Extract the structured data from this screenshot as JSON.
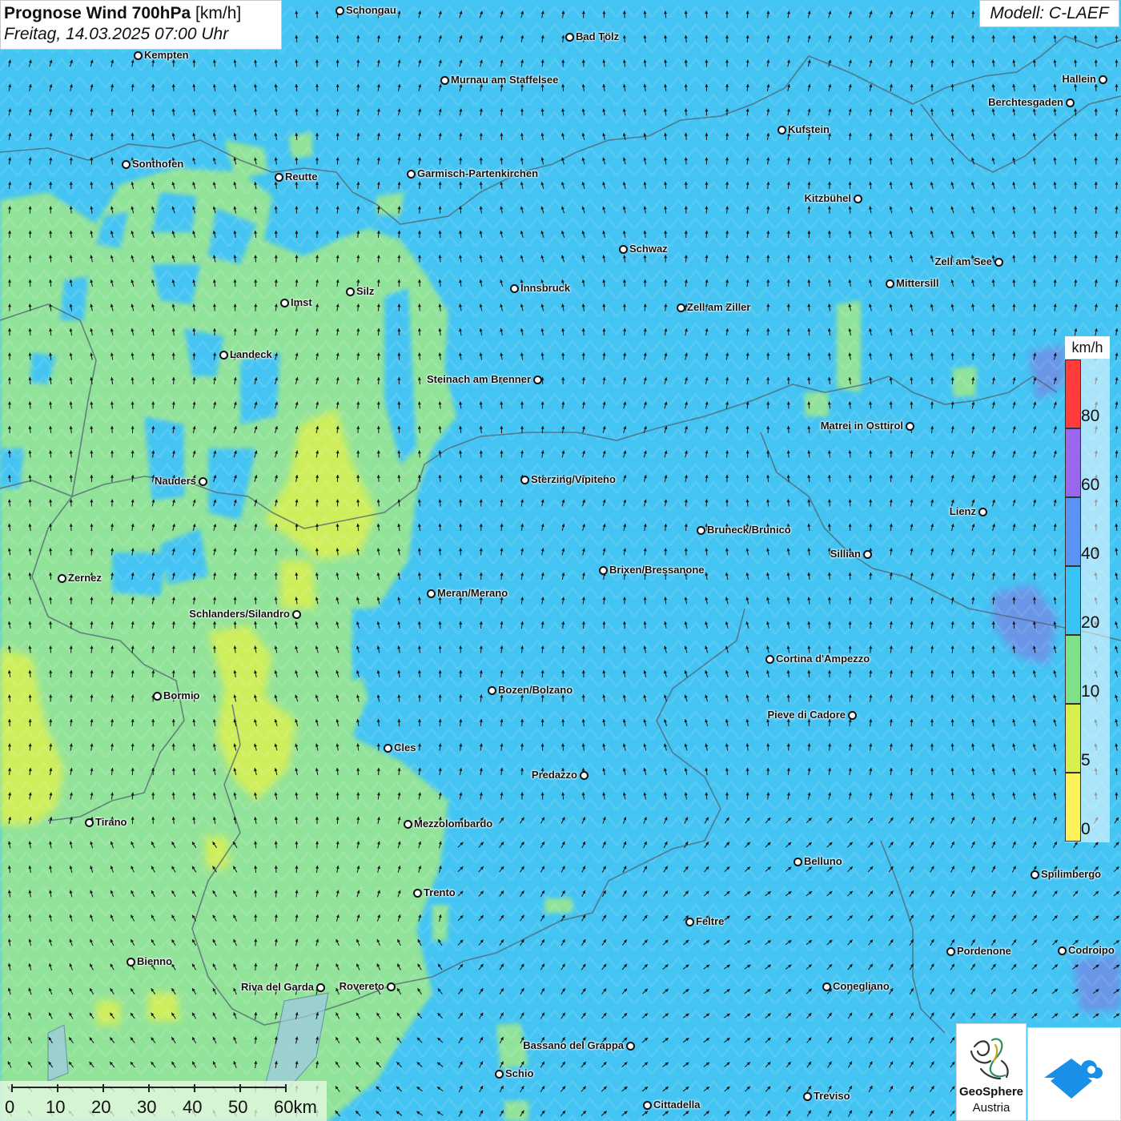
{
  "header": {
    "title_bold": "Prognose Wind 700hPa",
    "title_unit": "[km/h]",
    "date_line": "Freitag, 14.03.2025 07:00 Uhr"
  },
  "model": {
    "label": "Modell: C-LAEF"
  },
  "legend": {
    "unit": "km/h",
    "ticks": [
      "80",
      "60",
      "40",
      "20",
      "10",
      "5",
      "0"
    ],
    "colors": [
      "#ff3b3b",
      "#9a66ee",
      "#5b93f2",
      "#38c3f5",
      "#7fe28a",
      "#d8ef4e",
      "#fdf25a"
    ]
  },
  "scale_bar": {
    "labels": [
      "0",
      "10",
      "20",
      "30",
      "40",
      "50",
      "60km"
    ]
  },
  "cities": [
    {
      "name": "Schongau"
    },
    {
      "name": "Bad Tölz"
    },
    {
      "name": "Kempten"
    },
    {
      "name": "Murnau am Staffelsee"
    },
    {
      "name": "Hallein"
    },
    {
      "name": "Berchtesgaden"
    },
    {
      "name": "Kufstein"
    },
    {
      "name": "Sonthofen"
    },
    {
      "name": "Reutte"
    },
    {
      "name": "Garmisch-Partenkirchen"
    },
    {
      "name": "Kitzbühel"
    },
    {
      "name": "Schwaz"
    },
    {
      "name": "Zell am See"
    },
    {
      "name": "Mittersill"
    },
    {
      "name": "Innsbruck"
    },
    {
      "name": "Silz"
    },
    {
      "name": "Imst"
    },
    {
      "name": "Zell am Ziller"
    },
    {
      "name": "Landeck"
    },
    {
      "name": "Steinach am Brenner"
    },
    {
      "name": "Matrei in Osttirol"
    },
    {
      "name": "Nauders"
    },
    {
      "name": "Sterzing/Vipiteno"
    },
    {
      "name": "Lienz"
    },
    {
      "name": "Bruneck/Brunico"
    },
    {
      "name": "Sillian"
    },
    {
      "name": "Brixen/Bressanone"
    },
    {
      "name": "Zernez"
    },
    {
      "name": "Meran/Merano"
    },
    {
      "name": "Schlanders/Silandro"
    },
    {
      "name": "Cortina d'Ampezzo"
    },
    {
      "name": "Bozen/Bolzano"
    },
    {
      "name": "Bormio"
    },
    {
      "name": "Pieve di Cadore"
    },
    {
      "name": "Cles"
    },
    {
      "name": "Predazzo"
    },
    {
      "name": "Tirano"
    },
    {
      "name": "Mezzolombardo"
    },
    {
      "name": "Belluno"
    },
    {
      "name": "Spilimbergo"
    },
    {
      "name": "Trento"
    },
    {
      "name": "Feltre"
    },
    {
      "name": "Pordenone"
    },
    {
      "name": "Codroipo"
    },
    {
      "name": "Bienno"
    },
    {
      "name": "Riva del Garda"
    },
    {
      "name": "Rovereto"
    },
    {
      "name": "Conegliano"
    },
    {
      "name": "Bassano del Grappa"
    },
    {
      "name": "Schio"
    },
    {
      "name": "Treviso"
    },
    {
      "name": "Cittadella"
    }
  ],
  "logo": {
    "line1": "GeoSphere",
    "line2": "Austria"
  }
}
